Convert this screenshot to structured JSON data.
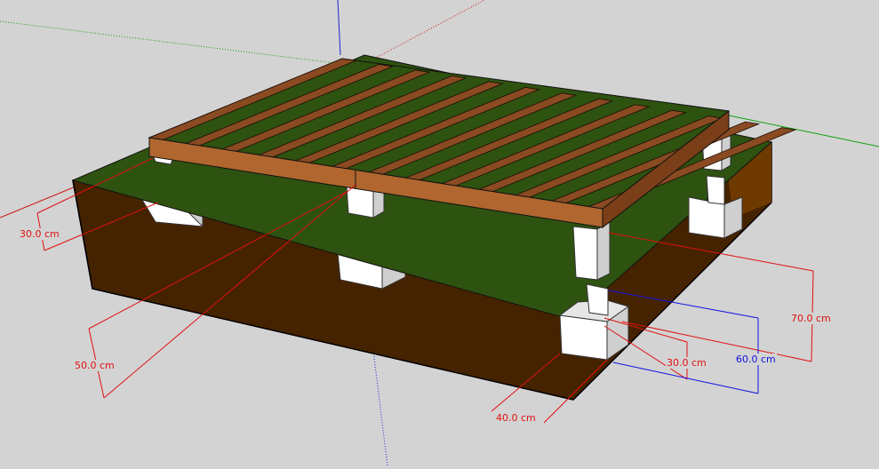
{
  "scene": {
    "colors": {
      "background": "#d3d3d3",
      "soil": "#462300",
      "soil_wall": "#6e3a00",
      "ground": "#2e5210",
      "wood_top": "#8a4a22",
      "wood_side": "#b0662e",
      "concrete": "#ffffff",
      "dim_red": "#e01010",
      "dim_blue": "#1010e0"
    },
    "joist_count": 13
  },
  "dimensions": [
    {
      "label": "30.0 cm",
      "color": "#e01010"
    },
    {
      "label": "50.0 cm",
      "color": "#e01010"
    },
    {
      "label": "40.0 cm",
      "color": "#e01010"
    },
    {
      "label": "30.0 cm",
      "color": "#e01010"
    },
    {
      "label": "60.0 cm",
      "color": "#1010e0"
    },
    {
      "label": "70.0 cm",
      "color": "#e01010"
    }
  ]
}
